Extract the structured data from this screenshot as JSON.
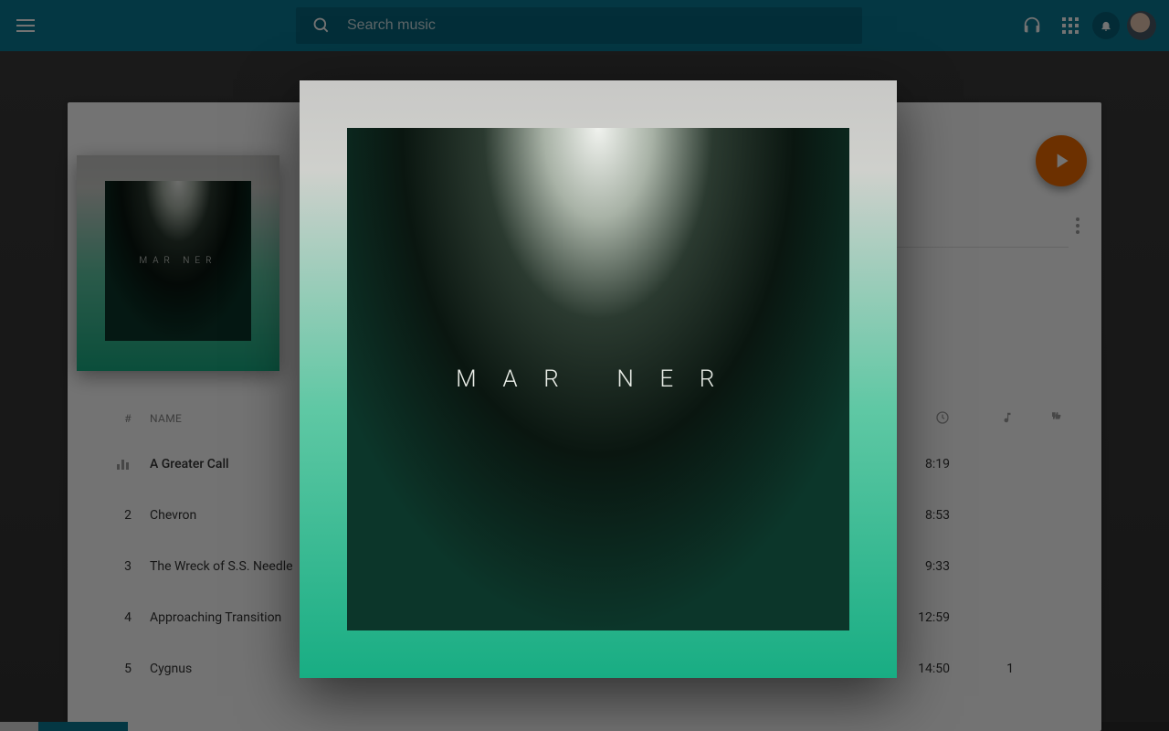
{
  "header": {
    "search_placeholder": "Search music"
  },
  "album": {
    "cover_text": "MAR  NER"
  },
  "table": {
    "col_num": "#",
    "col_name": "NAME"
  },
  "tracks": [
    {
      "num": "",
      "name": "A Greater Call",
      "duration": "8:19",
      "plays": "",
      "now_playing": true
    },
    {
      "num": "2",
      "name": "Chevron",
      "duration": "8:53",
      "plays": ""
    },
    {
      "num": "3",
      "name": "The Wreck of S.S. Needle",
      "duration": "9:33",
      "plays": ""
    },
    {
      "num": "4",
      "name": "Approaching Transition",
      "duration": "12:59",
      "plays": ""
    },
    {
      "num": "5",
      "name": "Cygnus",
      "duration": "14:50",
      "plays": "1"
    }
  ],
  "modal": {
    "cover_text": "MAR  NER"
  }
}
